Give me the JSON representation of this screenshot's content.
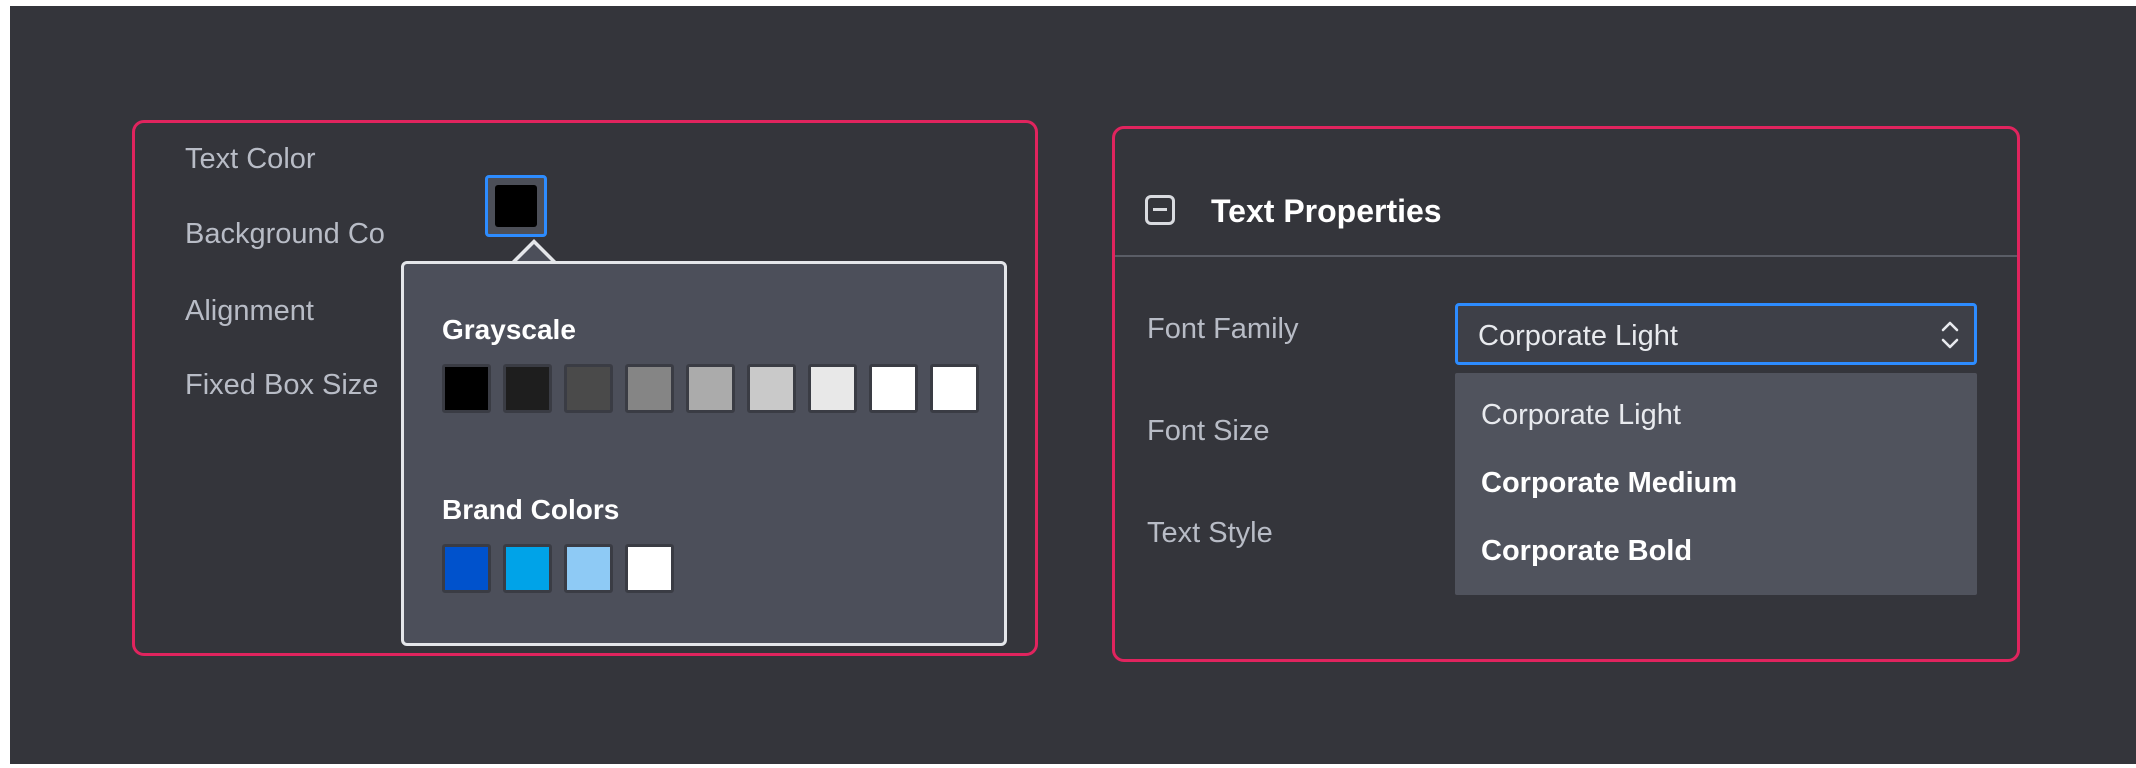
{
  "left_panel": {
    "labels": {
      "text_color": "Text Color",
      "background_color": "Background Co",
      "alignment": "Alignment",
      "fixed_box_size": "Fixed Box Size"
    },
    "selected_text_color": "#000000",
    "color_picker": {
      "grayscale_heading": "Grayscale",
      "grayscale": [
        "#000000",
        "#1e1e1e",
        "#4a4a4a",
        "#858585",
        "#ababab",
        "#c9c9c9",
        "#e8e8e8",
        "#ffffff",
        "#ffffff"
      ],
      "brand_heading": "Brand Colors",
      "brand": [
        "#0052cc",
        "#00a3e8",
        "#8ecaf5",
        "#ffffff"
      ]
    }
  },
  "right_panel": {
    "section_title": "Text Properties",
    "labels": {
      "font_family": "Font Family",
      "font_size": "Font Size",
      "text_style": "Text Style"
    },
    "font_family_select": {
      "value": "Corporate Light",
      "options": [
        "Corporate Light",
        "Corporate Medium",
        "Corporate Bold"
      ]
    }
  },
  "colors": {
    "background": "#34353b",
    "highlight_border": "#e0245e",
    "focus_accent": "#2d8cff"
  }
}
